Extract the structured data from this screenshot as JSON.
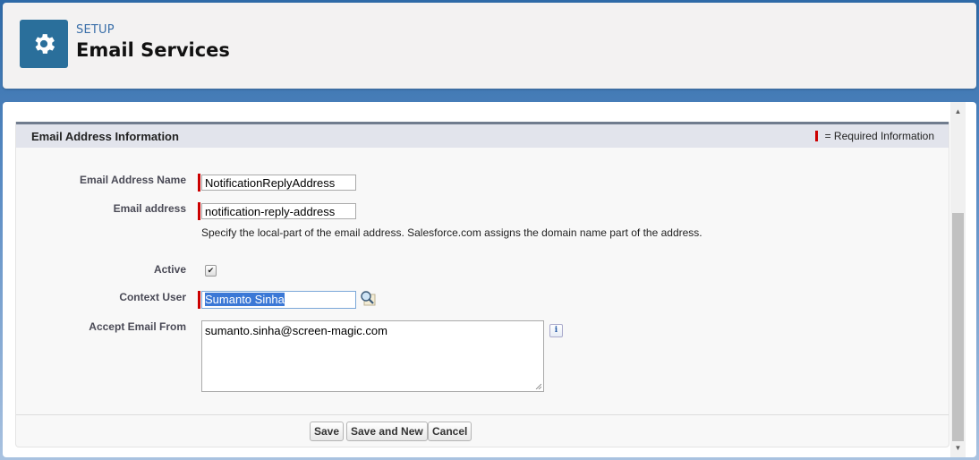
{
  "header": {
    "eyebrow": "SETUP",
    "title": "Email Services",
    "icon": "gear-icon",
    "icon_bg": "#2a6f9b"
  },
  "section": {
    "title": "Email Address Information",
    "required_legend": "= Required Information",
    "required_color": "#cc0000"
  },
  "fields": {
    "email_address_name": {
      "label": "Email Address Name",
      "value": "NotificationReplyAddress",
      "required": true
    },
    "email_address": {
      "label": "Email address",
      "value": "notification-reply-address",
      "required": true,
      "help": "Specify the local-part of the email address. Salesforce.com assigns the domain name part of the address."
    },
    "active": {
      "label": "Active",
      "checked": true,
      "check_glyph": "✔"
    },
    "context_user": {
      "label": "Context User",
      "value": "Sumanto Sinha",
      "required": true,
      "lookup_icon": "lookup-magnifier-icon"
    },
    "accept_email_from": {
      "label": "Accept Email From",
      "value": "sumanto.sinha@screen-magic.com",
      "info_glyph": "i"
    }
  },
  "buttons": {
    "save": "Save",
    "save_and_new": "Save and New",
    "cancel": "Cancel"
  },
  "scrollbar": {
    "up_glyph": "▲",
    "down_glyph": "▼"
  }
}
